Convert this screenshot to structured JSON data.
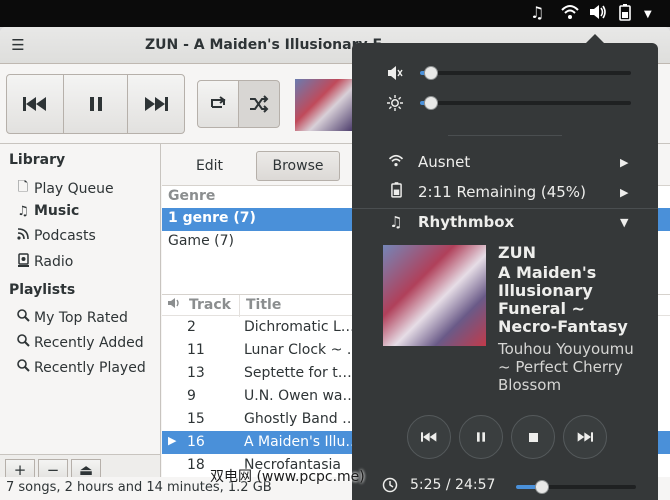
{
  "topbar": {
    "icons": [
      "music-note-icon",
      "wifi-icon",
      "volume-icon",
      "battery-icon",
      "dropdown-arrow-icon"
    ]
  },
  "window": {
    "title": "ZUN - A Maiden's Illusionary F"
  },
  "toolbar": {
    "prev_label": "previous",
    "pause_label": "pause",
    "next_label": "next",
    "repeat_label": "repeat",
    "shuffle_label": "shuffle"
  },
  "sidebar": {
    "library_heading": "Library",
    "library_items": [
      {
        "label": "Play Queue",
        "icon": "file-icon"
      },
      {
        "label": "Music",
        "icon": "music-icon"
      },
      {
        "label": "Podcasts",
        "icon": "rss-icon"
      },
      {
        "label": "Radio",
        "icon": "radio-icon"
      }
    ],
    "playlists_heading": "Playlists",
    "playlist_items": [
      {
        "label": "My Top Rated",
        "icon": "search-icon"
      },
      {
        "label": "Recently Added",
        "icon": "search-icon"
      },
      {
        "label": "Recently Played",
        "icon": "search-icon"
      }
    ],
    "add_label": "+",
    "remove_label": "−",
    "eject_label": "⏏"
  },
  "content": {
    "tabs": {
      "edit": "Edit",
      "browse": "Browse"
    },
    "genre_header": "Genre",
    "genres": [
      "1 genre (7)",
      "Game (7)"
    ],
    "track_col": "Track",
    "title_col": "Title",
    "tracks": [
      {
        "num": "2",
        "title": "Dichromatic L…"
      },
      {
        "num": "11",
        "title": "Lunar Clock ~ …"
      },
      {
        "num": "13",
        "title": "Septette for t…"
      },
      {
        "num": "9",
        "title": "U.N. Owen wa…"
      },
      {
        "num": "15",
        "title": "Ghostly Band …"
      },
      {
        "num": "16",
        "title": "A Maiden's Illu…",
        "playing": true
      },
      {
        "num": "18",
        "title": "Necrofantasia"
      }
    ]
  },
  "statusbar": {
    "text": "7 songs, 2 hours and 14 minutes, 1.2 GB"
  },
  "popover": {
    "volume_level": 0.05,
    "brightness_level": 0.05,
    "wifi_label": "Ausnet",
    "battery_label": "2:11 Remaining (45%)",
    "player_label": "Rhythmbox",
    "artist": "ZUN",
    "track_title": "A Maiden's Illusionary Funeral ~ Necro-Fantasy",
    "album": "Touhou Youyoumu ~ Perfect Cherry Blossom",
    "time": "5:25 / 24:57",
    "progress": 0.22
  },
  "watermark": "双电网 (www.pcpc.me)",
  "colors": {
    "accent": "#4a90d9",
    "popover_bg": "#353839",
    "topbar_bg": "#0b0b0b"
  }
}
